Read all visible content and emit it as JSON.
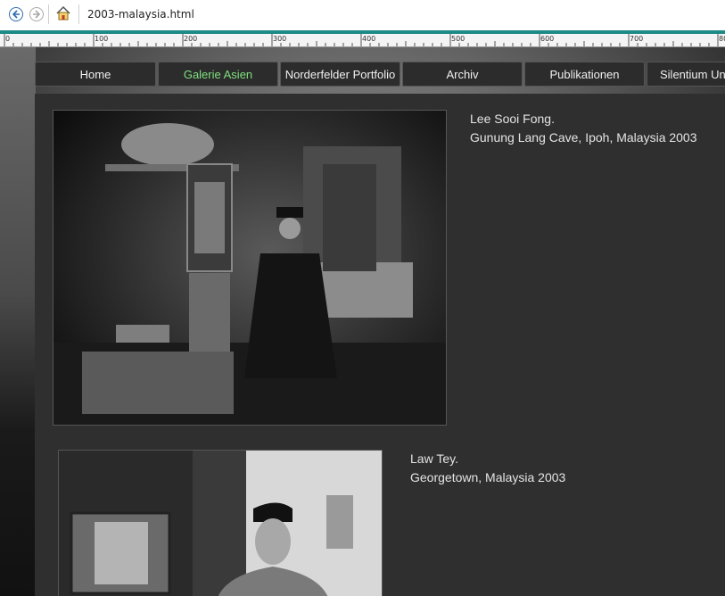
{
  "browser": {
    "url": "2003-malaysia.html",
    "icons": {
      "back": "back-arrow-icon",
      "forward": "forward-arrow-icon",
      "home": "home-icon"
    }
  },
  "ruler": {
    "labels": [
      "0",
      "100",
      "200",
      "300",
      "400",
      "500",
      "600",
      "700",
      "80"
    ]
  },
  "menu": {
    "items": [
      {
        "label": "Home"
      },
      {
        "label": "Galerie Asien"
      },
      {
        "label": "Norderfelder Portfolio"
      },
      {
        "label": "Archiv"
      },
      {
        "label": "Publikationen"
      },
      {
        "label": "Silentium Un"
      }
    ],
    "active_color": "#7fe07f"
  },
  "gallery": {
    "photos": [
      {
        "caption_name": "Lee Sooi Fong.",
        "caption_place": "Gunung Lang Cave, Ipoh, Malaysia 2003"
      },
      {
        "caption_name": "Law Tey.",
        "caption_place": "Georgetown, Malaysia 2003"
      }
    ]
  },
  "colors": {
    "accent_bar": "#1c8a87",
    "content_bg": "#2f2f2f"
  }
}
